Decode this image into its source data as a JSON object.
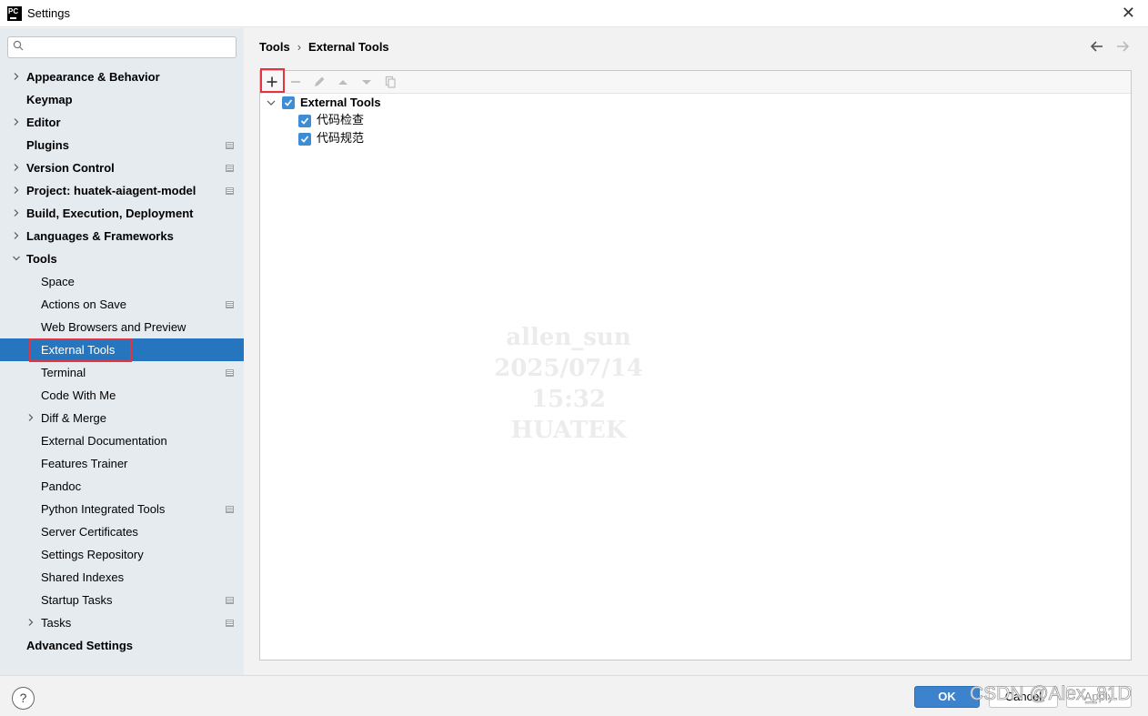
{
  "window": {
    "title": "Settings",
    "app_badge": "PC"
  },
  "search": {
    "placeholder": "",
    "value": ""
  },
  "sidebar": {
    "items": [
      {
        "label": "Appearance & Behavior",
        "level": 0,
        "bold": true,
        "chevron": "right",
        "project_icon": false
      },
      {
        "label": "Keymap",
        "level": 0,
        "bold": true,
        "chevron": "",
        "project_icon": false
      },
      {
        "label": "Editor",
        "level": 0,
        "bold": true,
        "chevron": "right",
        "project_icon": false
      },
      {
        "label": "Plugins",
        "level": 0,
        "bold": true,
        "chevron": "",
        "project_icon": true
      },
      {
        "label": "Version Control",
        "level": 0,
        "bold": true,
        "chevron": "right",
        "project_icon": true
      },
      {
        "label": "Project: huatek-aiagent-model",
        "level": 0,
        "bold": true,
        "chevron": "right",
        "project_icon": true
      },
      {
        "label": "Build, Execution, Deployment",
        "level": 0,
        "bold": true,
        "chevron": "right",
        "project_icon": false
      },
      {
        "label": "Languages & Frameworks",
        "level": 0,
        "bold": true,
        "chevron": "right",
        "project_icon": false
      },
      {
        "label": "Tools",
        "level": 0,
        "bold": true,
        "chevron": "down",
        "project_icon": false
      },
      {
        "label": "Space",
        "level": 1,
        "bold": false,
        "chevron": "",
        "project_icon": false
      },
      {
        "label": "Actions on Save",
        "level": 1,
        "bold": false,
        "chevron": "",
        "project_icon": true
      },
      {
        "label": "Web Browsers and Preview",
        "level": 1,
        "bold": false,
        "chevron": "",
        "project_icon": false
      },
      {
        "label": "External Tools",
        "level": 1,
        "bold": false,
        "chevron": "",
        "project_icon": false,
        "selected": true
      },
      {
        "label": "Terminal",
        "level": 1,
        "bold": false,
        "chevron": "",
        "project_icon": true
      },
      {
        "label": "Code With Me",
        "level": 1,
        "bold": false,
        "chevron": "",
        "project_icon": false
      },
      {
        "label": "Diff & Merge",
        "level": 1,
        "bold": false,
        "chevron": "right",
        "project_icon": false
      },
      {
        "label": "External Documentation",
        "level": 1,
        "bold": false,
        "chevron": "",
        "project_icon": false
      },
      {
        "label": "Features Trainer",
        "level": 1,
        "bold": false,
        "chevron": "",
        "project_icon": false
      },
      {
        "label": "Pandoc",
        "level": 1,
        "bold": false,
        "chevron": "",
        "project_icon": false
      },
      {
        "label": "Python Integrated Tools",
        "level": 1,
        "bold": false,
        "chevron": "",
        "project_icon": true
      },
      {
        "label": "Server Certificates",
        "level": 1,
        "bold": false,
        "chevron": "",
        "project_icon": false
      },
      {
        "label": "Settings Repository",
        "level": 1,
        "bold": false,
        "chevron": "",
        "project_icon": false
      },
      {
        "label": "Shared Indexes",
        "level": 1,
        "bold": false,
        "chevron": "",
        "project_icon": false
      },
      {
        "label": "Startup Tasks",
        "level": 1,
        "bold": false,
        "chevron": "",
        "project_icon": true
      },
      {
        "label": "Tasks",
        "level": 1,
        "bold": false,
        "chevron": "right",
        "project_icon": true
      },
      {
        "label": "Advanced Settings",
        "level": 0,
        "bold": true,
        "chevron": "",
        "project_icon": false
      }
    ]
  },
  "breadcrumb": {
    "parent": "Tools",
    "separator": "›",
    "current": "External Tools"
  },
  "toolbar": {
    "buttons": [
      "add-icon",
      "remove-icon",
      "edit-icon",
      "move-up-icon",
      "move-down-icon",
      "copy-icon"
    ]
  },
  "tools_tree": {
    "group": {
      "label": "External Tools",
      "checked": true,
      "expanded": true
    },
    "items": [
      {
        "label": "代码检查",
        "checked": true
      },
      {
        "label": "代码规范",
        "checked": true
      }
    ]
  },
  "watermark": {
    "line1": "allen_sun",
    "line2": "2025/07/14 15:32",
    "line3": "HUATEK"
  },
  "footer": {
    "help_label": "?",
    "ok_label": "OK",
    "cancel_label": "Cancel",
    "apply_label": "Apply",
    "overlay_watermark": "CSDN @Alex_81D"
  },
  "colors": {
    "selection": "#2675bf",
    "highlight_box": "#e5333f",
    "checkbox": "#3d8cd6",
    "sidebar_bg": "#e6ebf0"
  }
}
